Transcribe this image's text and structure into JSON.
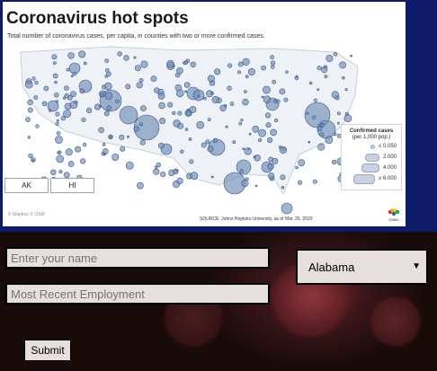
{
  "infographic": {
    "title": "Coronavirus hot spots",
    "subtitle": "Total number of coronavirus cases, per capita, in counties with two or more confirmed cases.",
    "inset_ak": "AK",
    "inset_hi": "HI",
    "legend": {
      "title_line1": "Confirmed cases",
      "title_line2": "(per 1,000 pop.)",
      "items": [
        "≤ 0.050",
        "2.000",
        "4.000",
        "≥ 6.000"
      ]
    },
    "source": "SOURCE: Johns Hopkins University, as of Mar. 26, 2020",
    "attribution": "© Mapbox © OSM",
    "brand": "CNBC",
    "colors": {
      "frame_bg": "#0e1b6b",
      "bubble": "#6f8db7",
      "bubble_edge": "#3a5a8a"
    }
  },
  "form": {
    "name_placeholder": "Enter your name",
    "employment_placeholder": "Most Recent Employment",
    "state_selected": "Alabama",
    "submit_label": "Submit"
  }
}
